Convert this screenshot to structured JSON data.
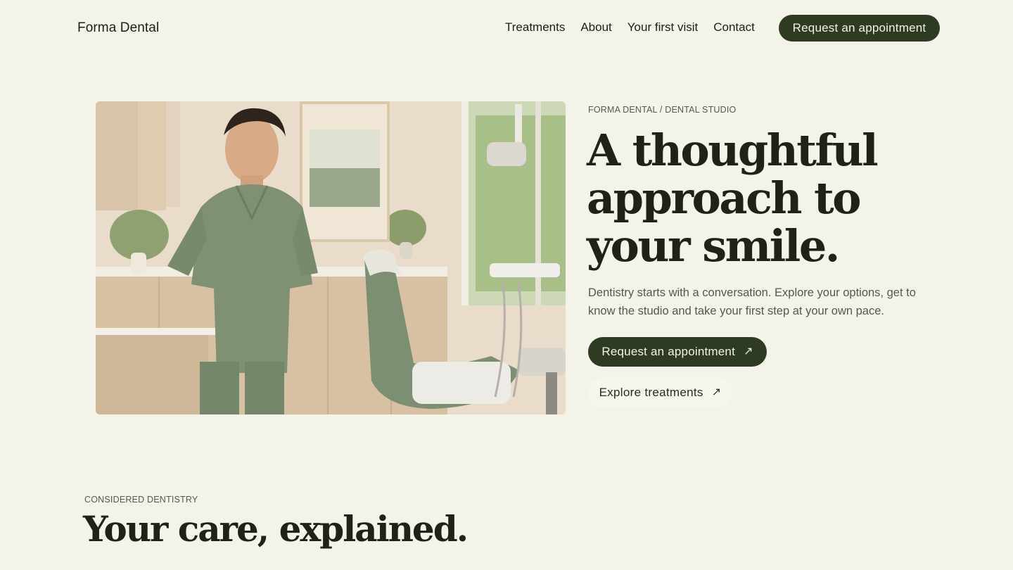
{
  "header": {
    "brand": "Forma Dental",
    "nav": [
      "Treatments",
      "About",
      "Your first visit",
      "Contact"
    ],
    "cta": "Request an appointment"
  },
  "hero": {
    "eyebrow": "FORMA DENTAL / DENTAL STUDIO",
    "headline": "A thoughtful approach to your smile.",
    "lead": "Dentistry starts with a conversation. Explore your options, get to know the studio and take your first step at your own pace.",
    "primary_cta": "Request an appointment",
    "secondary_cta": "Explore treatments",
    "arrow_icon": "↗",
    "image_icon": "dentist-photo"
  },
  "section": {
    "eyebrow": "CONSIDERED DENTISTRY",
    "title": "Your care, explained."
  },
  "colors": {
    "background": "#f3f3ea",
    "accent": "#2f3a22",
    "text": "#1f2218",
    "muted": "#55584d"
  }
}
